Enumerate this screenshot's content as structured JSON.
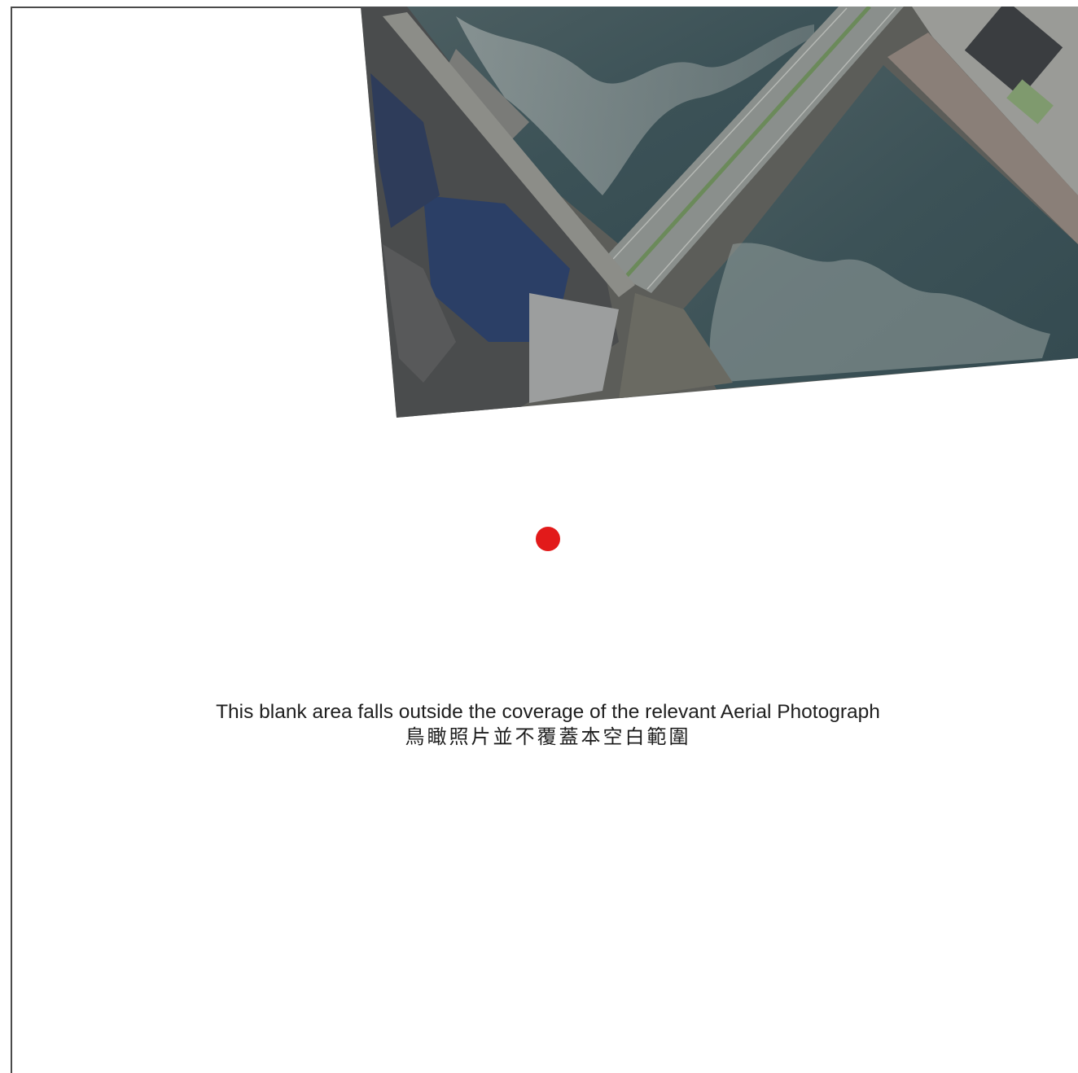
{
  "map": {
    "colors": {
      "water": "#3f5459",
      "water_glare": "#8a9393",
      "road": "#8a8f8c",
      "building_blue": "#2b3f66",
      "land": "#6f6d66",
      "marker": "#e21a1a",
      "frame": "#4a4a4a"
    },
    "marker": {
      "icon": "red-dot-location-marker"
    }
  },
  "notice": {
    "english": "This blank area falls outside the coverage of the relevant Aerial Photograph",
    "chinese": "鳥瞰照片並不覆蓋本空白範圍"
  }
}
